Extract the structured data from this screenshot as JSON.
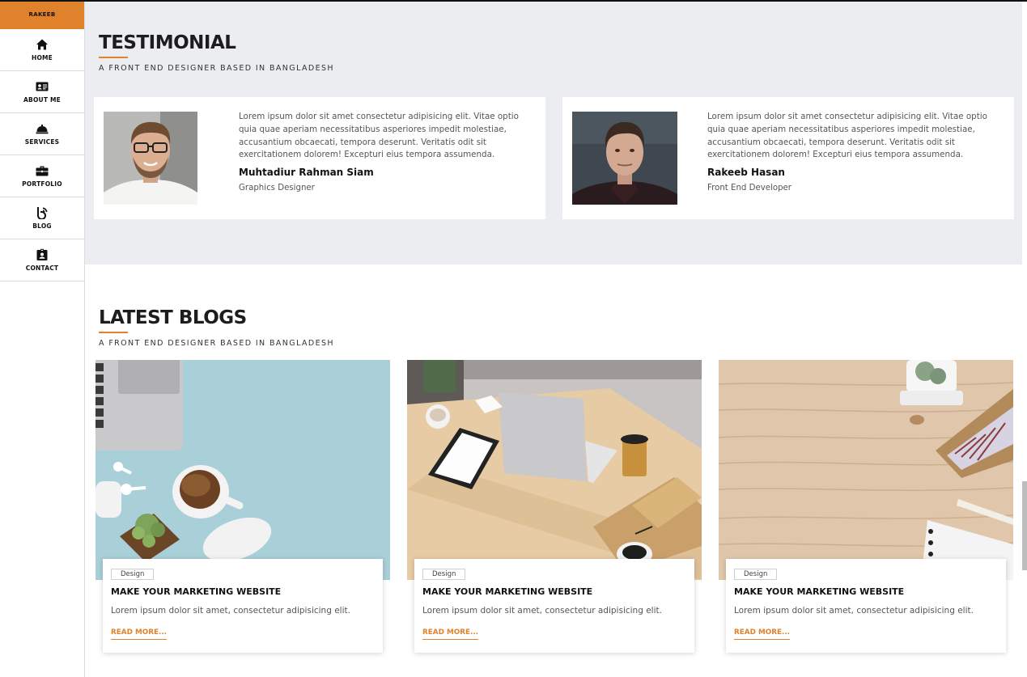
{
  "colors": {
    "accent": "#e0822c",
    "section_bg": "#ebedf1",
    "sidebar_bg": "#ffffff"
  },
  "sidebar": {
    "brand": "RAKEEB",
    "items": [
      {
        "label": "HOME",
        "icon": "home-icon"
      },
      {
        "label": "ABOUT ME",
        "icon": "id-card-icon"
      },
      {
        "label": "SERVICES",
        "icon": "bell-icon"
      },
      {
        "label": "PORTFOLIO",
        "icon": "briefcase-icon"
      },
      {
        "label": "BLOG",
        "icon": "blog-icon"
      },
      {
        "label": "CONTACT",
        "icon": "contact-badge-icon"
      }
    ]
  },
  "testimonial": {
    "title": "TESTIMONIAL",
    "subtitle": "A FRONT END DESIGNER BASED IN BANGLADESH",
    "cards": [
      {
        "text": "Lorem ipsum dolor sit amet consectetur adipisicing elit. Vitae optio quia quae aperiam necessitatibus asperiores impedit molestiae, accusantium obcaecati, tempora deserunt. Veritatis odit sit exercitationem dolorem! Excepturi eius tempora assumenda.",
        "name": "Muhtadiur Rahman Siam",
        "role": "Graphics Designer"
      },
      {
        "text": "Lorem ipsum dolor sit amet consectetur adipisicing elit. Vitae optio quia quae aperiam necessitatibus asperiores impedit molestiae, accusantium obcaecati, tempora deserunt. Veritatis odit sit exercitationem dolorem! Excepturi eius tempora assumenda.",
        "name": "Rakeeb Hasan",
        "role": "Front End Developer"
      }
    ]
  },
  "blogs": {
    "title": "LATEST BLOGS",
    "subtitle": "A FRONT END DESIGNER BASED IN BANGLADESH",
    "posts": [
      {
        "tag": "Design",
        "title": "MAKE YOUR MARKETING WEBSITE",
        "excerpt": "Lorem ipsum dolor sit amet, consectetur adipisicing elit.",
        "read_more": "READ MORE..."
      },
      {
        "tag": "Design",
        "title": "MAKE YOUR MARKETING WEBSITE",
        "excerpt": "Lorem ipsum dolor sit amet, consectetur adipisicing elit.",
        "read_more": "READ MORE..."
      },
      {
        "tag": "Design",
        "title": "MAKE YOUR MARKETING WEBSITE",
        "excerpt": "Lorem ipsum dolor sit amet, consectetur adipisicing elit.",
        "read_more": "READ MORE..."
      }
    ]
  }
}
